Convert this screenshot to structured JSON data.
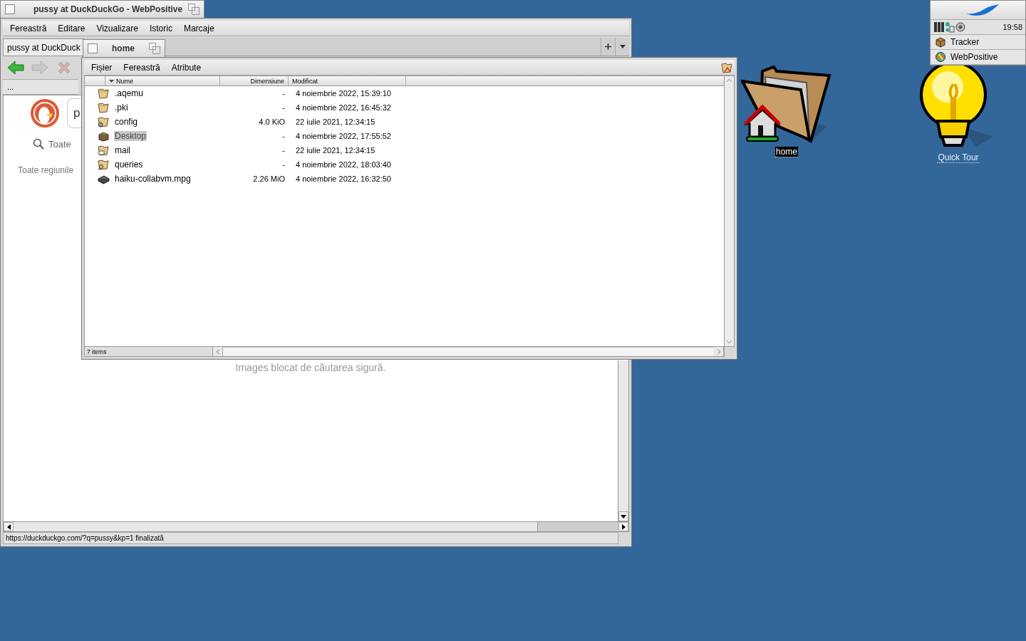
{
  "browser": {
    "window_title": "pussy at DuckDuckGo - WebPositive",
    "menu": [
      "Fereastră",
      "Editare",
      "Vizualizare",
      "Istoric",
      "Marcaje"
    ],
    "tabs": [
      {
        "label": "pussy at DuckDuck",
        "selected": true
      }
    ],
    "nav_buttons": [
      {
        "kind": "back",
        "disabled": false
      },
      {
        "kind": "forward",
        "disabled": true
      },
      {
        "kind": "stop",
        "disabled": true
      }
    ],
    "address_field": "...",
    "page": {
      "search_value": "p",
      "filter": "Toate",
      "region": "Toate regiunile",
      "message": "Images blocat de căutarea sigură."
    },
    "status_bar": "https://duckduckgo.com/?q=pussy&kp=1 finalizată"
  },
  "tracker": {
    "window_title": "home",
    "menu": [
      "Fișier",
      "Fereastră",
      "Atribute"
    ],
    "columns": [
      "Nume",
      "Dimensiune",
      "Modificat"
    ],
    "rows": [
      {
        "name": ".aqemu",
        "size": "-",
        "modified": "4 noiembrie 2022, 15:39:10",
        "kind": "folder",
        "selected": false
      },
      {
        "name": ".pki",
        "size": "-",
        "modified": "4 noiembrie 2022, 16:45:32",
        "kind": "folder",
        "selected": false
      },
      {
        "name": "config",
        "size": "4.0 KiO",
        "modified": "22 iulie 2021, 12:34:15",
        "kind": "config",
        "selected": false
      },
      {
        "name": "Desktop",
        "size": "-",
        "modified": "4 noiembrie 2022, 17:55:52",
        "kind": "desktop",
        "selected": true
      },
      {
        "name": "mail",
        "size": "-",
        "modified": "22 iulie 2021, 12:34:15",
        "kind": "mail",
        "selected": false
      },
      {
        "name": "queries",
        "size": "-",
        "modified": "4 noiembrie 2022, 18:03:40",
        "kind": "query",
        "selected": false
      },
      {
        "name": "haiku-collabvm.mpg",
        "size": "2.26 MiO",
        "modified": "4 noiembrie 2022, 16:32:50",
        "kind": "video",
        "selected": false
      }
    ],
    "status_bar": "7 items"
  },
  "desktop_icons": [
    {
      "label": "home",
      "kind": "home",
      "selected": true
    },
    {
      "label": "Quick Tour",
      "kind": "bulb",
      "selected": false
    }
  ],
  "deskbar": {
    "clock": "19:58",
    "apps": [
      {
        "label": "Tracker",
        "kind": "tracker"
      },
      {
        "label": "WebPositive",
        "kind": "web"
      }
    ]
  }
}
